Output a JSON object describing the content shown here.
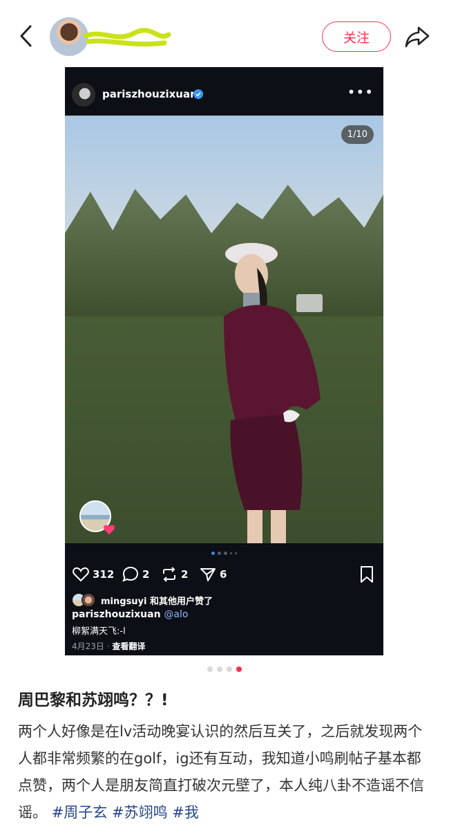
{
  "header": {
    "follow_label": "关注",
    "username_obscured": "",
    "icons": {
      "back": "back-chevron-icon",
      "share": "share-arrow-icon"
    }
  },
  "ig_post": {
    "username": "pariszhouzixuan",
    "verified": true,
    "counter": "1/10",
    "stats": {
      "likes": "312",
      "comments": "2",
      "reposts": "2",
      "shares": "6"
    },
    "liked_by": "mingsuyi 和其他用户赞了",
    "caption_user": "pariszhouzixuan",
    "caption_mention": "@alo",
    "caption_text": "柳絮满天飞:-l",
    "date": "4月23日 ·",
    "translate": "查看翻译",
    "image_dots": 5,
    "image_dot_active": 1
  },
  "carousel": {
    "count": 4,
    "active": 4
  },
  "note": {
    "title": "周巴黎和苏翊鸣？？!",
    "body": "两个人好像是在lv活动晚宴认识的然后互关了，之后就发现两个人都非常频繁的在golf，ig还有互动，我知道小鸣刷帖子基本都点赞，两个人是朋友简直打破次元壁了，本人纯八卦不造谣不信谣。",
    "tags": [
      "#周子玄",
      "#苏翊鸣",
      "#我"
    ]
  },
  "colors": {
    "accent": "#ff2e4d",
    "tag": "#25468a",
    "ig_bg": "#0c0f15"
  }
}
